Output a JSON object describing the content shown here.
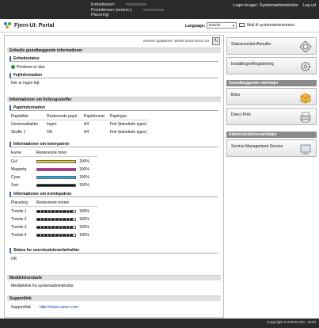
{
  "header": {
    "device_name_label": "Enhedsnavn:",
    "product_name_label": "Produktnavn (serienr.):",
    "location_label": "Placering:",
    "login_user": "Login-bruger: Systemadministrator",
    "logout": "Log ud"
  },
  "titlebar": {
    "title": "Fjern-UI: Portal",
    "language_label": "Language:",
    "language_value": "Danish",
    "mail_link": "Mail til systemadministrator"
  },
  "status": {
    "updated": "Senest opdateret: 19/06 2019 03:01:44"
  },
  "sections": {
    "basic_info": "Enhedis grundlæggende informationer",
    "device_status_head": "Enhedsstatus",
    "device_status_text": "Printeren er klar.",
    "error_info_head": "Fejlinformation",
    "error_info_text": "Der er ingen fejl.",
    "consumables": "Informationer om forbrugsstoffer",
    "paper_info": "Papirinformation",
    "toner_info": "Informationer om tonerpatron",
    "drum_info": "Informationer om tromlepatron",
    "waste_toner": "Status for overskudstonerbeholder",
    "waste_toner_value": "OK",
    "message_board": "Meddelelsestavle",
    "message_text": "Meddelelse fra systemadministrator.",
    "support_link": "Supportlink",
    "support_label": "Supportlink",
    "support_url": "http://www.canon.com"
  },
  "paper_table": {
    "headers": [
      "Papirkilde",
      "Resterende papir",
      "Papirformat",
      "Papirtype"
    ],
    "rows": [
      [
        "Universalbakke",
        "Ingen",
        "A4",
        "Fmt (blandede typer)"
      ],
      [
        "Skuffe 1",
        "OK",
        "A4",
        "Fmt (blandede typer)"
      ]
    ]
  },
  "toner_table": {
    "headers": [
      "Farve",
      "Resterende toner"
    ],
    "rows": [
      {
        "name": "Gul",
        "percent": "100%",
        "color": "#f2d21a"
      },
      {
        "name": "Magenta",
        "percent": "100%",
        "color": "#e81ba0"
      },
      {
        "name": "Cyan",
        "percent": "100%",
        "color": "#18b6e6"
      },
      {
        "name": "Sort",
        "percent": "100%",
        "color": "#111111"
      }
    ]
  },
  "drum_table": {
    "headers": [
      "Placering",
      "Resterende tromle"
    ],
    "rows": [
      {
        "name": "Tromle 1",
        "percent": "100%"
      },
      {
        "name": "Tromle 2",
        "percent": "100%"
      },
      {
        "name": "Tromle 3",
        "percent": "100%"
      },
      {
        "name": "Tromle 4",
        "percent": "100%"
      }
    ]
  },
  "sidebar": {
    "status_monitor": "Statusmonitor/Annuller",
    "settings": "Indstillinger/Registrering",
    "basic_tools": "Grundlæggende værktøjer",
    "box": "Boks",
    "direct_print": "Direct Print",
    "admin_tools": "Administrationsværktøjer",
    "service_mgmt": "Service Management Service"
  },
  "footer": {
    "copyright": "Copyright CANON INC. 2019"
  }
}
